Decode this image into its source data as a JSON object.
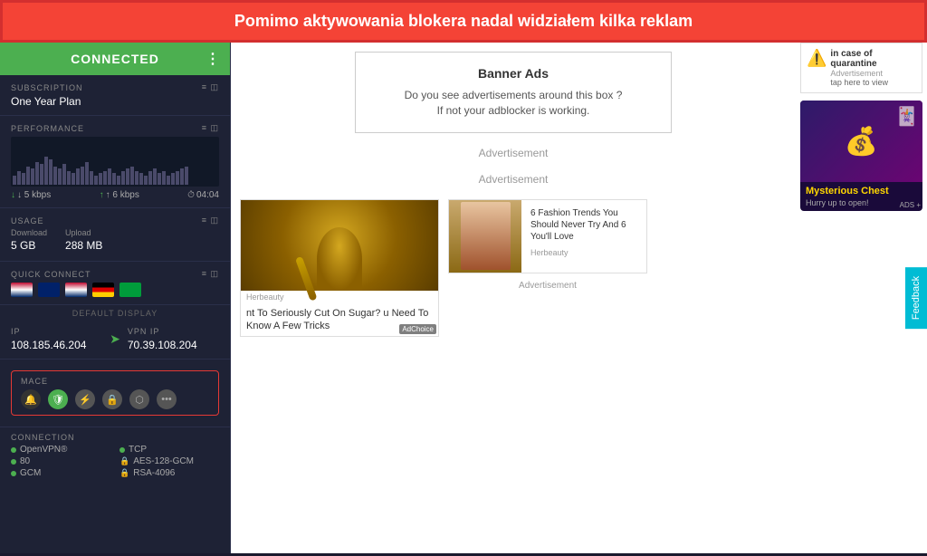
{
  "warning_banner": {
    "text": "Pomimo aktywowania blokera nadal widziałem kilka reklam"
  },
  "sidebar": {
    "connected_label": "CONNECTED",
    "subscription": {
      "label": "SUBSCRIPTION",
      "value": "One Year Plan"
    },
    "performance": {
      "label": "PERFORMANCE",
      "download_speed": "↓ 5 kbps",
      "upload_speed": "↑ 6 kbps",
      "time": "04:04"
    },
    "usage": {
      "label": "USAGE",
      "download_label": "Download",
      "download_value": "5 GB",
      "upload_label": "Upload",
      "upload_value": "288 MB"
    },
    "quick_connect": {
      "label": "QUICK CONNECT"
    },
    "default_display": "DEFAULT DISPLAY",
    "ip": {
      "label": "IP",
      "value": "108.185.46.204"
    },
    "vpn_ip": {
      "label": "VPN IP",
      "value": "70.39.108.204"
    },
    "mace": {
      "label": "MACE"
    },
    "connection": {
      "label": "CONNECTION",
      "protocol": "OpenVPN®",
      "port": "80",
      "mode": "GCM",
      "transport": "TCP",
      "encryption": "AES-128-GCM",
      "auth": "RSA-4096"
    }
  },
  "banner_ads": {
    "title": "Banner Ads",
    "text_line1": "Do you see advertisements around this box ?",
    "text_line2": "If not your adblocker is working."
  },
  "ads": {
    "advertisement_label": "Advertisement",
    "advertisement_label2": "Advertisement"
  },
  "article_sugar": {
    "title": "nt To Seriously Cut On Sugar? u Need To Know A Few Tricks",
    "source": "Herbeauty",
    "adchoices": "AdChoice"
  },
  "article_fashion": {
    "title": "6 Fashion Trends You Should Never Try And 6 You'll Love",
    "source": "Herbeauty",
    "advert_label": "Advertisement"
  },
  "right_ad_quarantine": {
    "title": "in case of quarantine",
    "label": "Advertisement",
    "action": "tap here to view"
  },
  "right_ad_chest": {
    "title": "Mysterious Chest",
    "subtitle": "Hurry up to open!",
    "ads_label": "ADS +"
  },
  "feedback": {
    "label": "Feedback"
  }
}
